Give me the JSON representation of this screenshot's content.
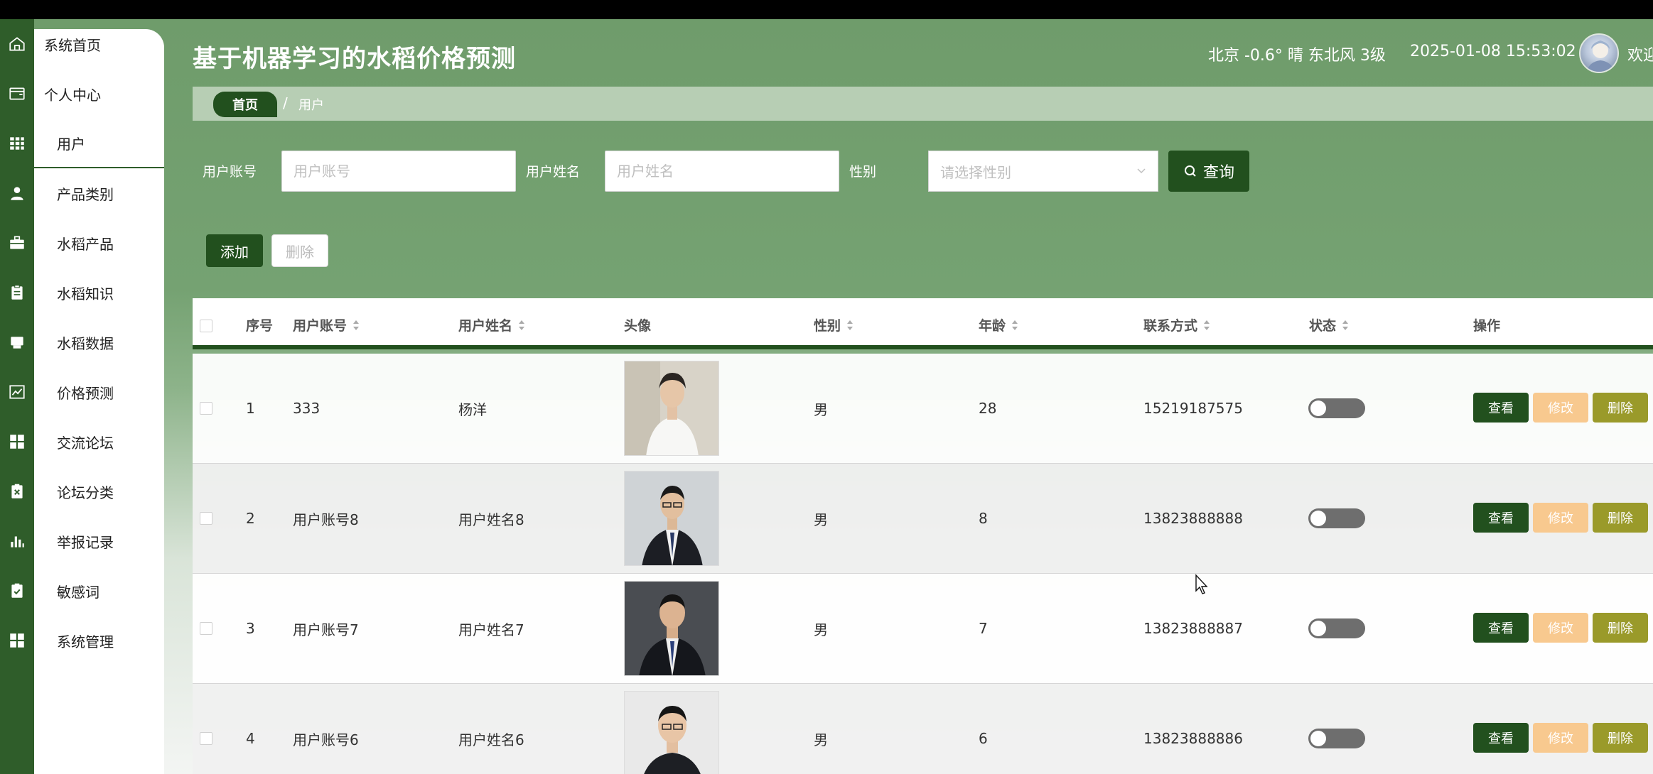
{
  "header": {
    "title": "基于机器学习的水稻价格预测",
    "weather": "北京 -0.6° 晴 东北风 3级",
    "datetime": "2025-01-08 15:53:02",
    "welcome": "欢迎"
  },
  "sidebar": {
    "items": [
      {
        "label": "系统首页",
        "icon": "home-icon"
      },
      {
        "label": "个人中心",
        "icon": "wallet-icon"
      },
      {
        "label": "用户",
        "icon": "grid-icon"
      },
      {
        "label": "产品类别",
        "icon": "user-icon"
      },
      {
        "label": "水稻产品",
        "icon": "briefcase-icon"
      },
      {
        "label": "水稻知识",
        "icon": "clipboard-icon"
      },
      {
        "label": "水稻数据",
        "icon": "printer-icon"
      },
      {
        "label": "价格预测",
        "icon": "trend-icon"
      },
      {
        "label": "交流论坛",
        "icon": "apps-icon"
      },
      {
        "label": "论坛分类",
        "icon": "clipboard-x-icon"
      },
      {
        "label": "举报记录",
        "icon": "bar-chart-icon"
      },
      {
        "label": "敏感词",
        "icon": "clipboard-check-icon"
      },
      {
        "label": "系统管理",
        "icon": "apps-icon"
      }
    ]
  },
  "breadcrumb": {
    "home": "首页",
    "separator": "/",
    "current": "用户"
  },
  "search": {
    "account_label": "用户账号",
    "account_placeholder": "用户账号",
    "name_label": "用户姓名",
    "name_placeholder": "用户姓名",
    "gender_label": "性别",
    "gender_placeholder": "请选择性别",
    "query_button": "查询"
  },
  "actions": {
    "add": "添加",
    "delete": "删除"
  },
  "table": {
    "columns": [
      "序号",
      "用户账号",
      "用户姓名",
      "头像",
      "性别",
      "年龄",
      "联系方式",
      "状态",
      "操作"
    ],
    "rows": [
      {
        "index": "1",
        "account": "333",
        "name": "杨洋",
        "gender": "男",
        "age": "28",
        "phone": "15219187575",
        "status": "off"
      },
      {
        "index": "2",
        "account": "用户账号8",
        "name": "用户姓名8",
        "gender": "男",
        "age": "8",
        "phone": "13823888888",
        "status": "off"
      },
      {
        "index": "3",
        "account": "用户账号7",
        "name": "用户姓名7",
        "gender": "男",
        "age": "7",
        "phone": "13823888887",
        "status": "off"
      },
      {
        "index": "4",
        "account": "用户账号6",
        "name": "用户姓名6",
        "gender": "男",
        "age": "6",
        "phone": "13823888886",
        "status": "off"
      }
    ],
    "row_actions": {
      "view": "查看",
      "edit": "修改",
      "delete": "删除"
    }
  },
  "colors": {
    "primary": "#22501e",
    "edit": "#f8c98f",
    "delete": "#9a9a2a",
    "background": "#75a272"
  }
}
